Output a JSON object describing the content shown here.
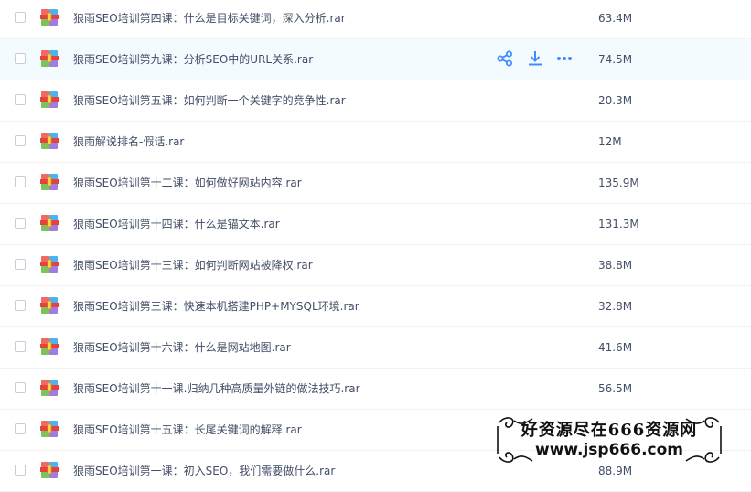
{
  "files": [
    {
      "name": "狼雨SEO培训第四课：什么是目标关键词，深入分析.rar",
      "size": "63.4M",
      "hover": false
    },
    {
      "name": "狼雨SEO培训第九课：分析SEO中的URL关系.rar",
      "size": "74.5M",
      "hover": true
    },
    {
      "name": "狼雨SEO培训第五课：如何判断一个关键字的竞争性.rar",
      "size": "20.3M",
      "hover": false
    },
    {
      "name": "狼雨解说排名-假话.rar",
      "size": "12M",
      "hover": false
    },
    {
      "name": "狼雨SEO培训第十二课：如何做好网站内容.rar",
      "size": "135.9M",
      "hover": false
    },
    {
      "name": "狼雨SEO培训第十四课：什么是锚文本.rar",
      "size": "131.3M",
      "hover": false
    },
    {
      "name": "狼雨SEO培训第十三课：如何判断网站被降权.rar",
      "size": "38.8M",
      "hover": false
    },
    {
      "name": "狼雨SEO培训第三课：快速本机搭建PHP+MYSQL环境.rar",
      "size": "32.8M",
      "hover": false
    },
    {
      "name": "狼雨SEO培训第十六课：什么是网站地图.rar",
      "size": "41.6M",
      "hover": false
    },
    {
      "name": "狼雨SEO培训第十一课.归纳几种高质量外链的做法技巧.rar",
      "size": "56.5M",
      "hover": false
    },
    {
      "name": "狼雨SEO培训第十五课：长尾关键词的解释.rar",
      "size": "",
      "hover": false
    },
    {
      "name": "狼雨SEO培训第一课：初入SEO，我们需要做什么.rar",
      "size": "88.9M",
      "hover": false
    }
  ],
  "row_actions": [
    "share-icon",
    "download-icon",
    "more-icon"
  ],
  "icon_name": "rar-archive-icon",
  "colors": {
    "accent": "#3b8cff",
    "text": "#424e67",
    "hover_bg": "#f4fbff"
  },
  "watermark": {
    "line1": "好资源尽在666资源网",
    "line2": "www.jsp666.com"
  }
}
